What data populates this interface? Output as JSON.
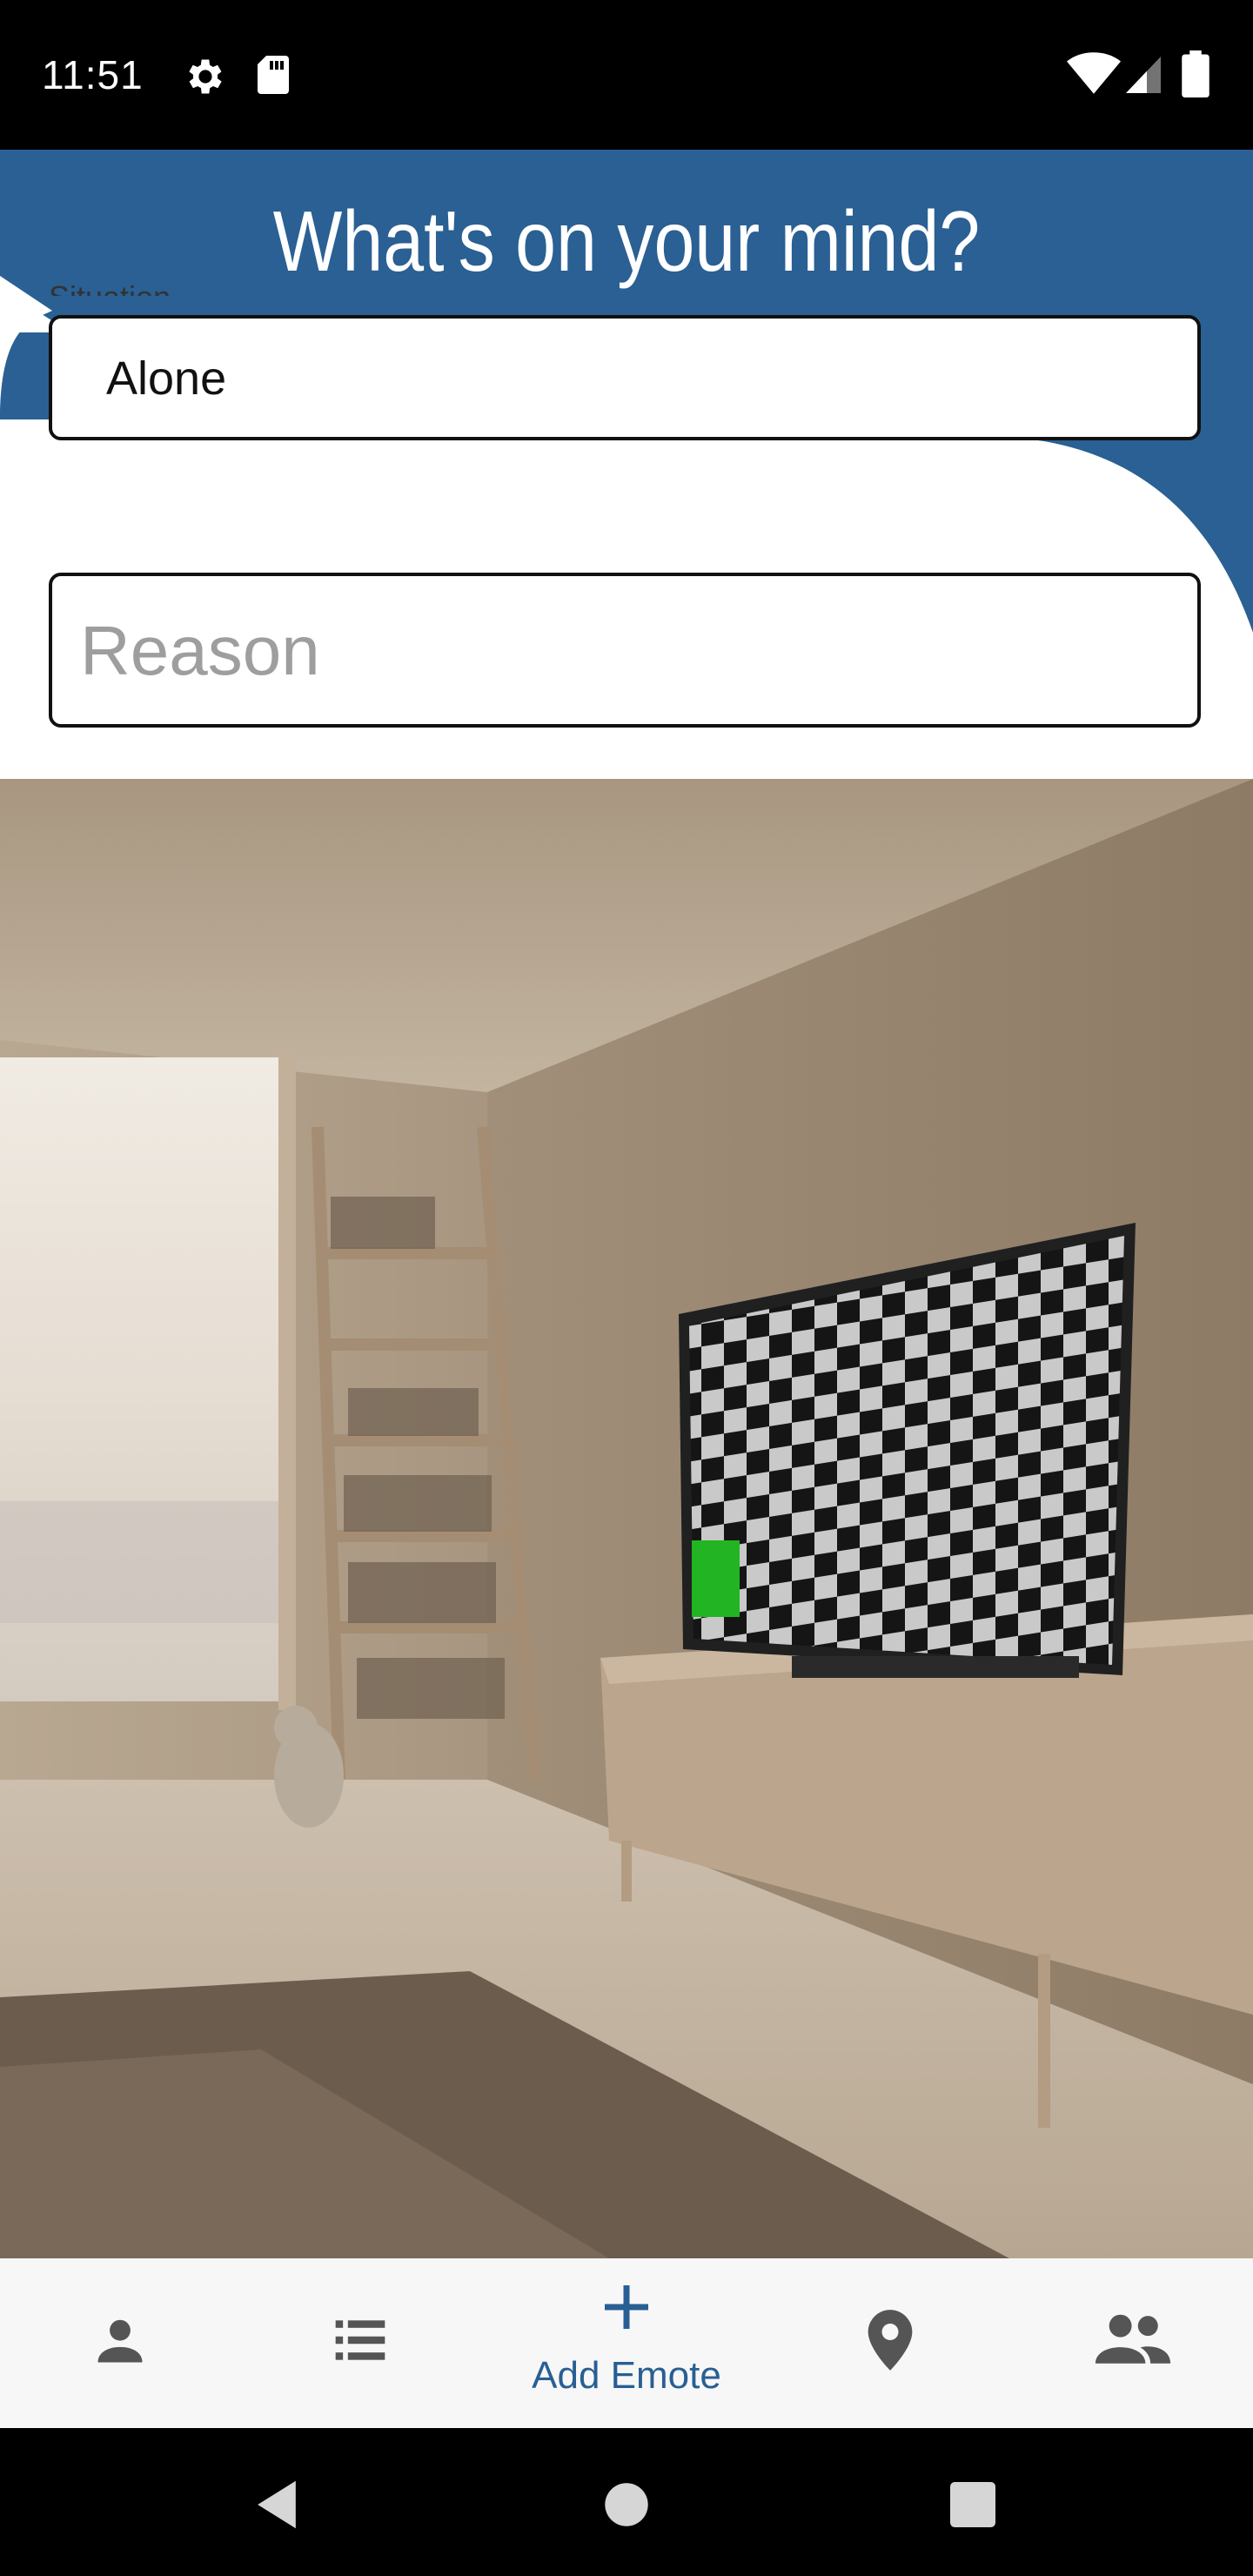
{
  "status": {
    "time": "11:51"
  },
  "header": {
    "title": "What's on your mind?"
  },
  "form": {
    "situation_label": "Situation",
    "situation_value": "Alone",
    "reason_placeholder": "Reason",
    "reason_value": ""
  },
  "bottom_nav": {
    "items": [
      {
        "icon": "person-icon",
        "label": ""
      },
      {
        "icon": "list-icon",
        "label": ""
      },
      {
        "icon": "plus-icon",
        "label": "Add Emote",
        "active": true
      },
      {
        "icon": "map-pin-icon",
        "label": ""
      },
      {
        "icon": "people-icon",
        "label": ""
      }
    ]
  },
  "colors": {
    "accent": "#285f94",
    "header_blue": "#2a6093",
    "tv_overlay_green": "#22b422"
  }
}
